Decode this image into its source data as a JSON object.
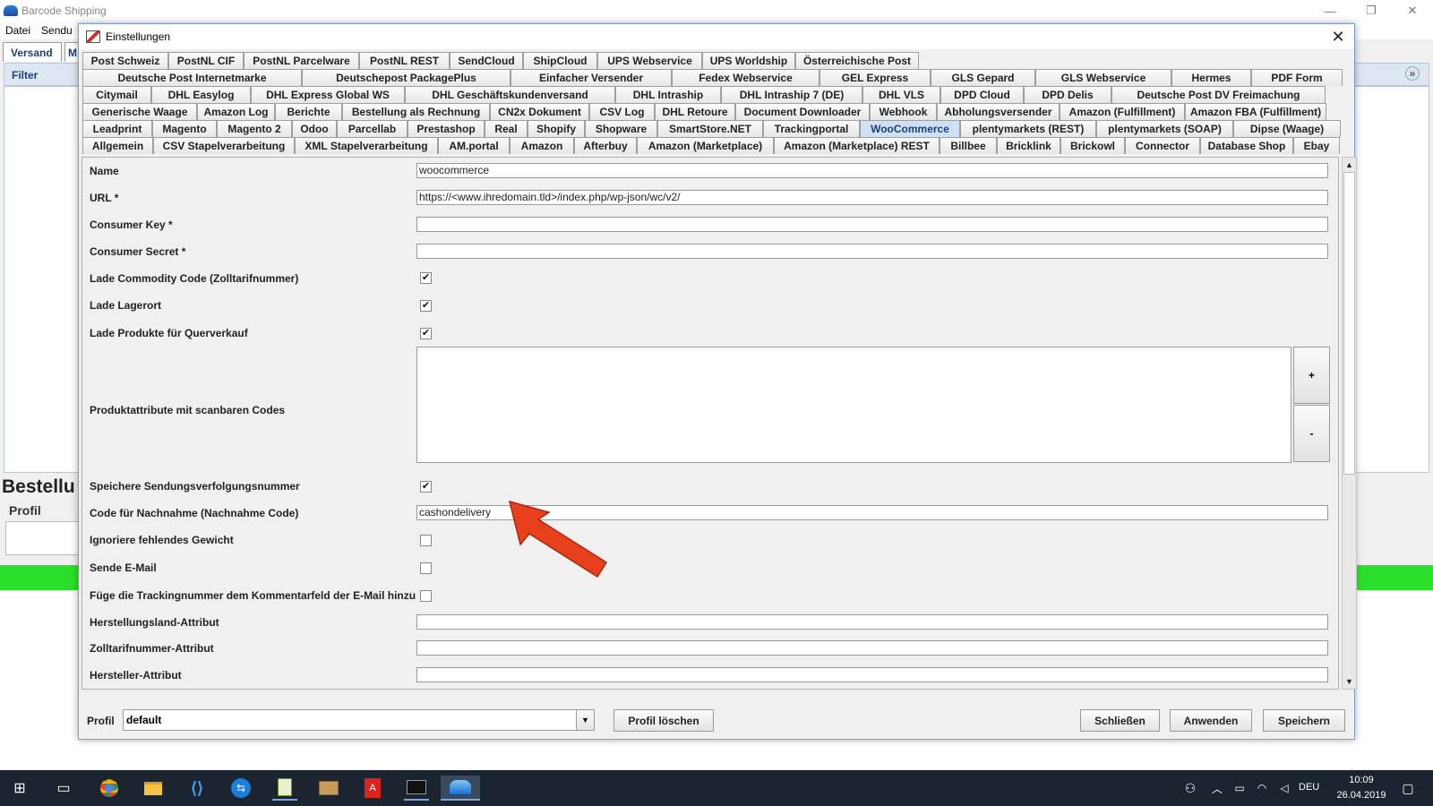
{
  "app": {
    "title": "Barcode Shipping",
    "menu": [
      "Datei",
      "Sendu"
    ],
    "bg_tabs": [
      "Versand",
      "M"
    ],
    "filter_label": "Filter",
    "bestell_label": "Bestellu",
    "profil_label": "Profil"
  },
  "dialog": {
    "title": "Einstellungen",
    "tab_rows": [
      [
        "Post Schweiz",
        "PostNL CIF",
        "PostNL Parcelware",
        "PostNL REST",
        "SendCloud",
        "ShipCloud",
        "UPS Webservice",
        "UPS Worldship",
        "Österreichische Post"
      ],
      [
        "Deutsche Post Internetmarke",
        "Deutschepost PackagePlus",
        "Einfacher Versender",
        "Fedex Webservice",
        "GEL Express",
        "GLS Gepard",
        "GLS Webservice",
        "Hermes",
        "PDF Form"
      ],
      [
        "Citymail",
        "DHL Easylog",
        "DHL Express Global WS",
        "DHL Geschäftskundenversand",
        "DHL Intraship",
        "DHL Intraship 7 (DE)",
        "DHL VLS",
        "DPD Cloud",
        "DPD Delis",
        "Deutsche Post DV Freimachung"
      ],
      [
        "Generische Waage",
        "Amazon Log",
        "Berichte",
        "Bestellung als Rechnung",
        "CN2x Dokument",
        "CSV Log",
        "DHL Retoure",
        "Document Downloader",
        "Webhook",
        "Abholungsversender",
        "Amazon (Fulfillment)",
        "Amazon FBA (Fulfillment)"
      ],
      [
        "Leadprint",
        "Magento",
        "Magento 2",
        "Odoo",
        "Parcellab",
        "Prestashop",
        "Real",
        "Shopify",
        "Shopware",
        "SmartStore.NET",
        "Trackingportal",
        "WooCommerce",
        "plentymarkets (REST)",
        "plentymarkets (SOAP)",
        "Dipse (Waage)"
      ],
      [
        "Allgemein",
        "CSV Stapelverarbeitung",
        "XML Stapelverarbeitung",
        "AM.portal",
        "Amazon",
        "Afterbuy",
        "Amazon (Marketplace)",
        "Amazon (Marketplace) REST",
        "Billbee",
        "Bricklink",
        "Brickowl",
        "Connector",
        "Database Shop",
        "Ebay"
      ]
    ],
    "active_tab": "WooCommerce",
    "form": {
      "name_label": "Name",
      "name_value": "woocommerce",
      "url_label": "URL *",
      "url_value": "https://<www.ihredomain.tld>/index.php/wp-json/wc/v2/",
      "key_label": "Consumer Key *",
      "key_value": "",
      "secret_label": "Consumer Secret *",
      "secret_value": "",
      "commodity_label": "Lade Commodity Code (Zolltarifnummer)",
      "commodity_checked": true,
      "lagerort_label": "Lade Lagerort",
      "lagerort_checked": true,
      "querverkauf_label": "Lade Produkte für Querverkauf",
      "querverkauf_checked": true,
      "attribute_label": "Produktattribute mit scanbaren Codes",
      "add_label": "+",
      "remove_label": "-",
      "tracking_label": "Speichere Sendungsverfolgungsnummer",
      "tracking_checked": true,
      "nachnahme_label": "Code für Nachnahme (Nachnahme Code)",
      "nachnahme_value": "cashondelivery",
      "gewicht_label": "Ignoriere fehlendes Gewicht",
      "gewicht_checked": false,
      "email_label": "Sende E-Mail",
      "email_checked": false,
      "kommentar_label": "Füge die Trackingnummer dem Kommentarfeld der E-Mail hinzu",
      "kommentar_checked": false,
      "herstellungsland_label": "Herstellungsland-Attribut",
      "herstellungsland_value": "",
      "zolltarif_label": "Zolltarifnummer-Attribut",
      "zolltarif_value": "",
      "hersteller_label": "Hersteller-Attribut",
      "hersteller_value": ""
    },
    "bottom": {
      "profil_label": "Profil",
      "profil_value": "default",
      "delete_label": "Profil löschen",
      "close_label": "Schließen",
      "apply_label": "Anwenden",
      "save_label": "Speichern"
    }
  },
  "taskbar": {
    "lang": "DEU",
    "time": "10:09",
    "date": "26.04.2019"
  },
  "colors": {
    "arrow": "#e8401c",
    "green_bar": "#2be02b",
    "active_tab": "#cfe1f5"
  }
}
